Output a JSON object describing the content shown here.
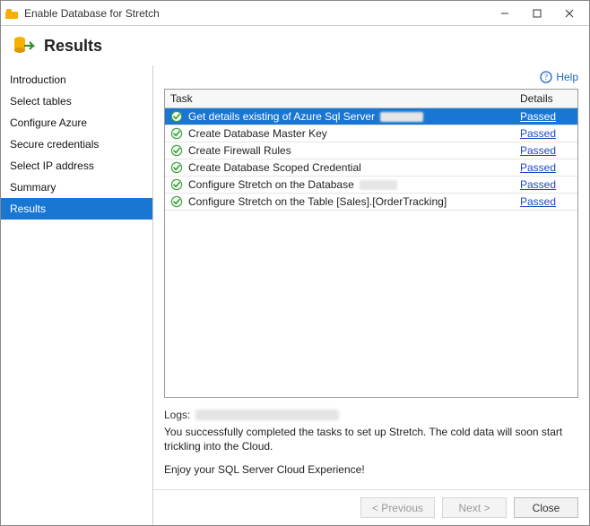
{
  "window": {
    "title": "Enable Database for Stretch"
  },
  "header": {
    "title": "Results"
  },
  "help": {
    "label": "Help"
  },
  "sidebar": {
    "items": [
      {
        "label": "Introduction",
        "selected": false
      },
      {
        "label": "Select tables",
        "selected": false
      },
      {
        "label": "Configure Azure",
        "selected": false
      },
      {
        "label": "Secure credentials",
        "selected": false
      },
      {
        "label": "Select IP address",
        "selected": false
      },
      {
        "label": "Summary",
        "selected": false
      },
      {
        "label": "Results",
        "selected": true
      }
    ]
  },
  "table": {
    "columns": {
      "task": "Task",
      "details": "Details"
    },
    "rows": [
      {
        "task": "Get details existing of Azure Sql Server",
        "obscured": true,
        "details": "Passed",
        "selected": true
      },
      {
        "task": "Create Database Master Key",
        "obscured": false,
        "details": "Passed",
        "selected": false
      },
      {
        "task": "Create Firewall Rules",
        "obscured": false,
        "details": "Passed",
        "selected": false
      },
      {
        "task": "Create Database Scoped Credential",
        "obscured": false,
        "details": "Passed",
        "selected": false
      },
      {
        "task": "Configure Stretch on the Database",
        "obscured": true,
        "details": "Passed",
        "selected": false
      },
      {
        "task": "Configure Stretch on the Table [Sales].[OrderTracking]",
        "obscured": false,
        "details": "Passed",
        "selected": false
      }
    ]
  },
  "logs": {
    "label": "Logs:"
  },
  "messages": {
    "line1": "You successfully completed the tasks to set up Stretch. The cold data will soon start trickling into the Cloud.",
    "line2": "Enjoy your SQL Server Cloud Experience!"
  },
  "buttons": {
    "previous": "< Previous",
    "next": "Next >",
    "close": "Close"
  },
  "colors": {
    "selection": "#1977d3",
    "link": "#1a49c0"
  }
}
